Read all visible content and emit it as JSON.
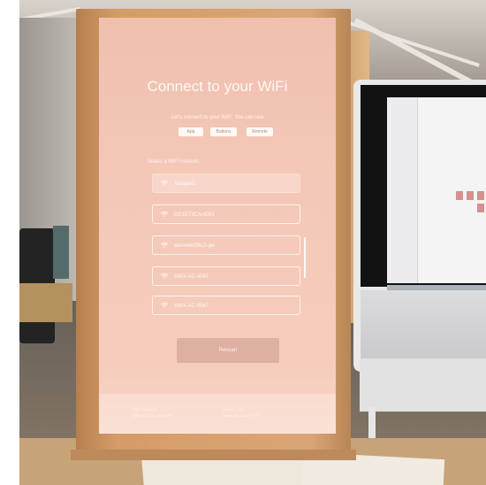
{
  "screen": {
    "title": "Connect to your WiFi",
    "subtitle": "Let's connect to your WiFi. You can use",
    "options": [
      "App",
      "Buttons",
      "Remote"
    ],
    "section_label": "Select a WiFi network.",
    "networks": [
      {
        "name": "TokapoG",
        "selected": true
      },
      {
        "name": "DD1E73CAAE61",
        "selected": false
      },
      {
        "name": "aterm6ef38c2-gw",
        "selected": false
      },
      {
        "name": "AWX-AC-4567",
        "selected": false
      },
      {
        "name": "AWX-AC-4567",
        "selected": false
      }
    ],
    "rescan_label": "Rescan",
    "footer": {
      "left_line1": "SSID: TokapoG",
      "left_line2": "MAC: 00:11:22:33:44:55",
      "right_line1": "Version: 1.1.0",
      "right_line2": "Serial: 00:22:AA:77:88"
    }
  },
  "colors": {
    "screen_bg": "#f4c8b8",
    "frame_wood": "#d49c67",
    "text": "#fff8f4"
  },
  "icons": {
    "network": "wifi-icon"
  }
}
